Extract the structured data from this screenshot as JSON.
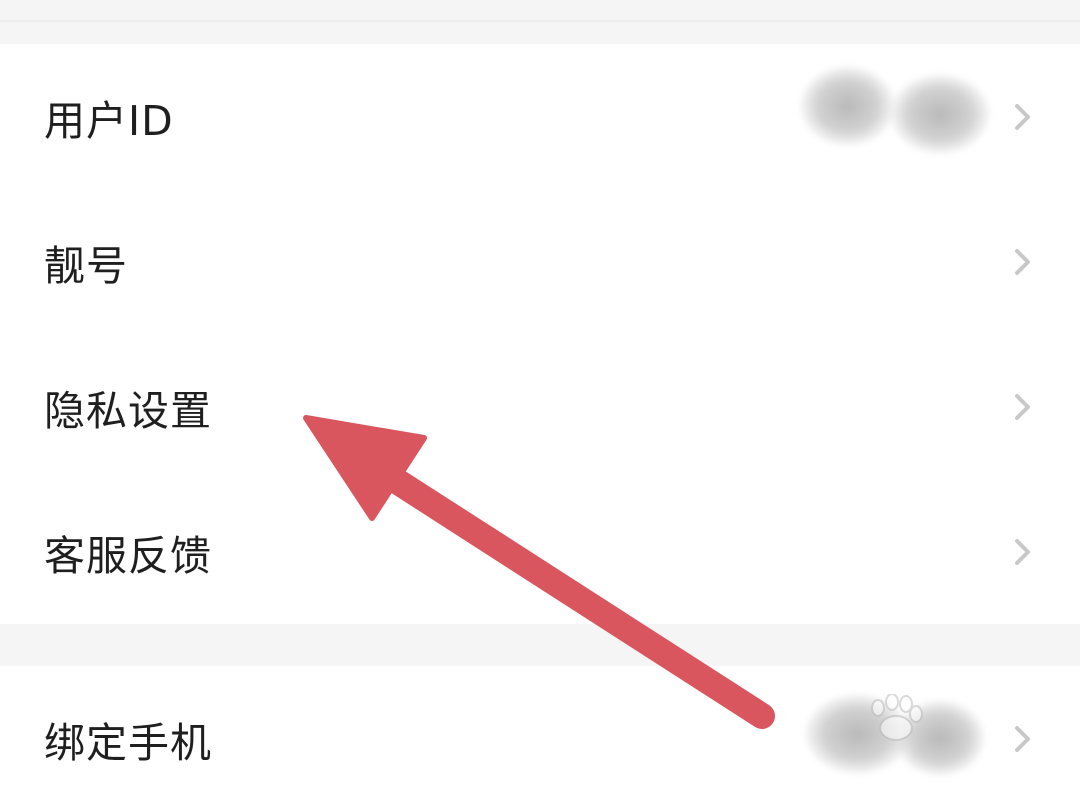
{
  "settings": {
    "rows": [
      {
        "label": "用户ID"
      },
      {
        "label": "靓号"
      },
      {
        "label": "隐私设置"
      },
      {
        "label": "客服反馈"
      },
      {
        "label": "绑定手机"
      }
    ]
  },
  "icons": {
    "chevron": "chevron-right-icon",
    "annotation": "red-arrow-icon"
  },
  "colors": {
    "background": "#f5f5f5",
    "row": "#ffffff",
    "text": "#1f1f1f",
    "chevron": "#c8c8c8",
    "annotation_arrow": "#d9565e"
  }
}
